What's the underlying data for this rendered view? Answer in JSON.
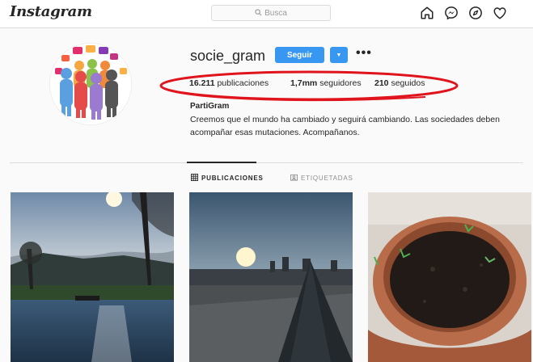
{
  "app": {
    "logo_text": "Instagram"
  },
  "search": {
    "placeholder": "Busca",
    "icon": "search-icon"
  },
  "nav": {
    "icons": [
      "home-icon",
      "messenger-icon",
      "explore-icon",
      "heart-icon"
    ]
  },
  "profile": {
    "username": "socie_gram",
    "follow_label": "Seguir",
    "fullname": "PartiGram",
    "bio": "Creemos que el mundo ha cambiado y seguirá cambiando. Las sociedades deben acompañar esas mutaciones. Acompañanos.",
    "stats": {
      "posts_count": "16.211",
      "posts_label": "publicaciones",
      "followers_count": "1,7mm",
      "followers_label": "seguidores",
      "following_count": "210",
      "following_label": "seguidos"
    }
  },
  "tabs": {
    "posts": "PUBLICACIONES",
    "tagged": "ETIQUETADAS"
  },
  "colors": {
    "accent": "#3897f0",
    "highlight_oval": "#e0141c"
  }
}
